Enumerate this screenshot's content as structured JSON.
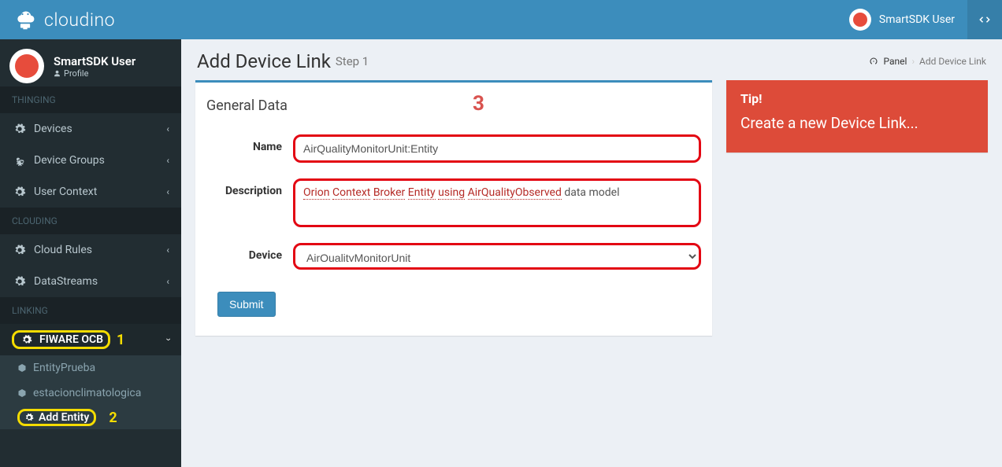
{
  "brand": "cloudino",
  "topbar_user": "SmartSDK User",
  "sidebar": {
    "user": {
      "name": "SmartSDK User",
      "sub": "Profile"
    },
    "sections": [
      {
        "header": "THINGING",
        "items": [
          {
            "label": "Devices"
          },
          {
            "label": "Device Groups"
          },
          {
            "label": "User Context"
          }
        ]
      },
      {
        "header": "CLOUDING",
        "items": [
          {
            "label": "Cloud Rules"
          },
          {
            "label": "DataStreams"
          }
        ]
      },
      {
        "header": "LINKING",
        "items": [
          {
            "label": "FIWARE OCB",
            "open": true,
            "sub": [
              {
                "label": "EntityPrueba"
              },
              {
                "label": "estacionclimatologica"
              },
              {
                "label": "Add Entity",
                "active": true
              }
            ]
          }
        ]
      }
    ]
  },
  "annotations": {
    "one": "1",
    "two": "2",
    "three": "3"
  },
  "page": {
    "title": "Add Device Link",
    "step": "Step 1",
    "breadcrumb_root": "Panel",
    "breadcrumb_current": "Add Device Link"
  },
  "panel_title": "General Data",
  "form": {
    "name_label": "Name",
    "name_value": "AirQualityMonitorUnit:Entity",
    "desc_label": "Description",
    "desc_words": [
      "Orion",
      "Context",
      "Broker",
      "Entity",
      "using",
      "AirQualityObserved"
    ],
    "desc_tail": " data model",
    "device_label": "Device",
    "device_value": "AirQualityMonitorUnit",
    "submit": "Submit"
  },
  "tip": {
    "title": "Tip!",
    "text": "Create a new Device Link..."
  }
}
